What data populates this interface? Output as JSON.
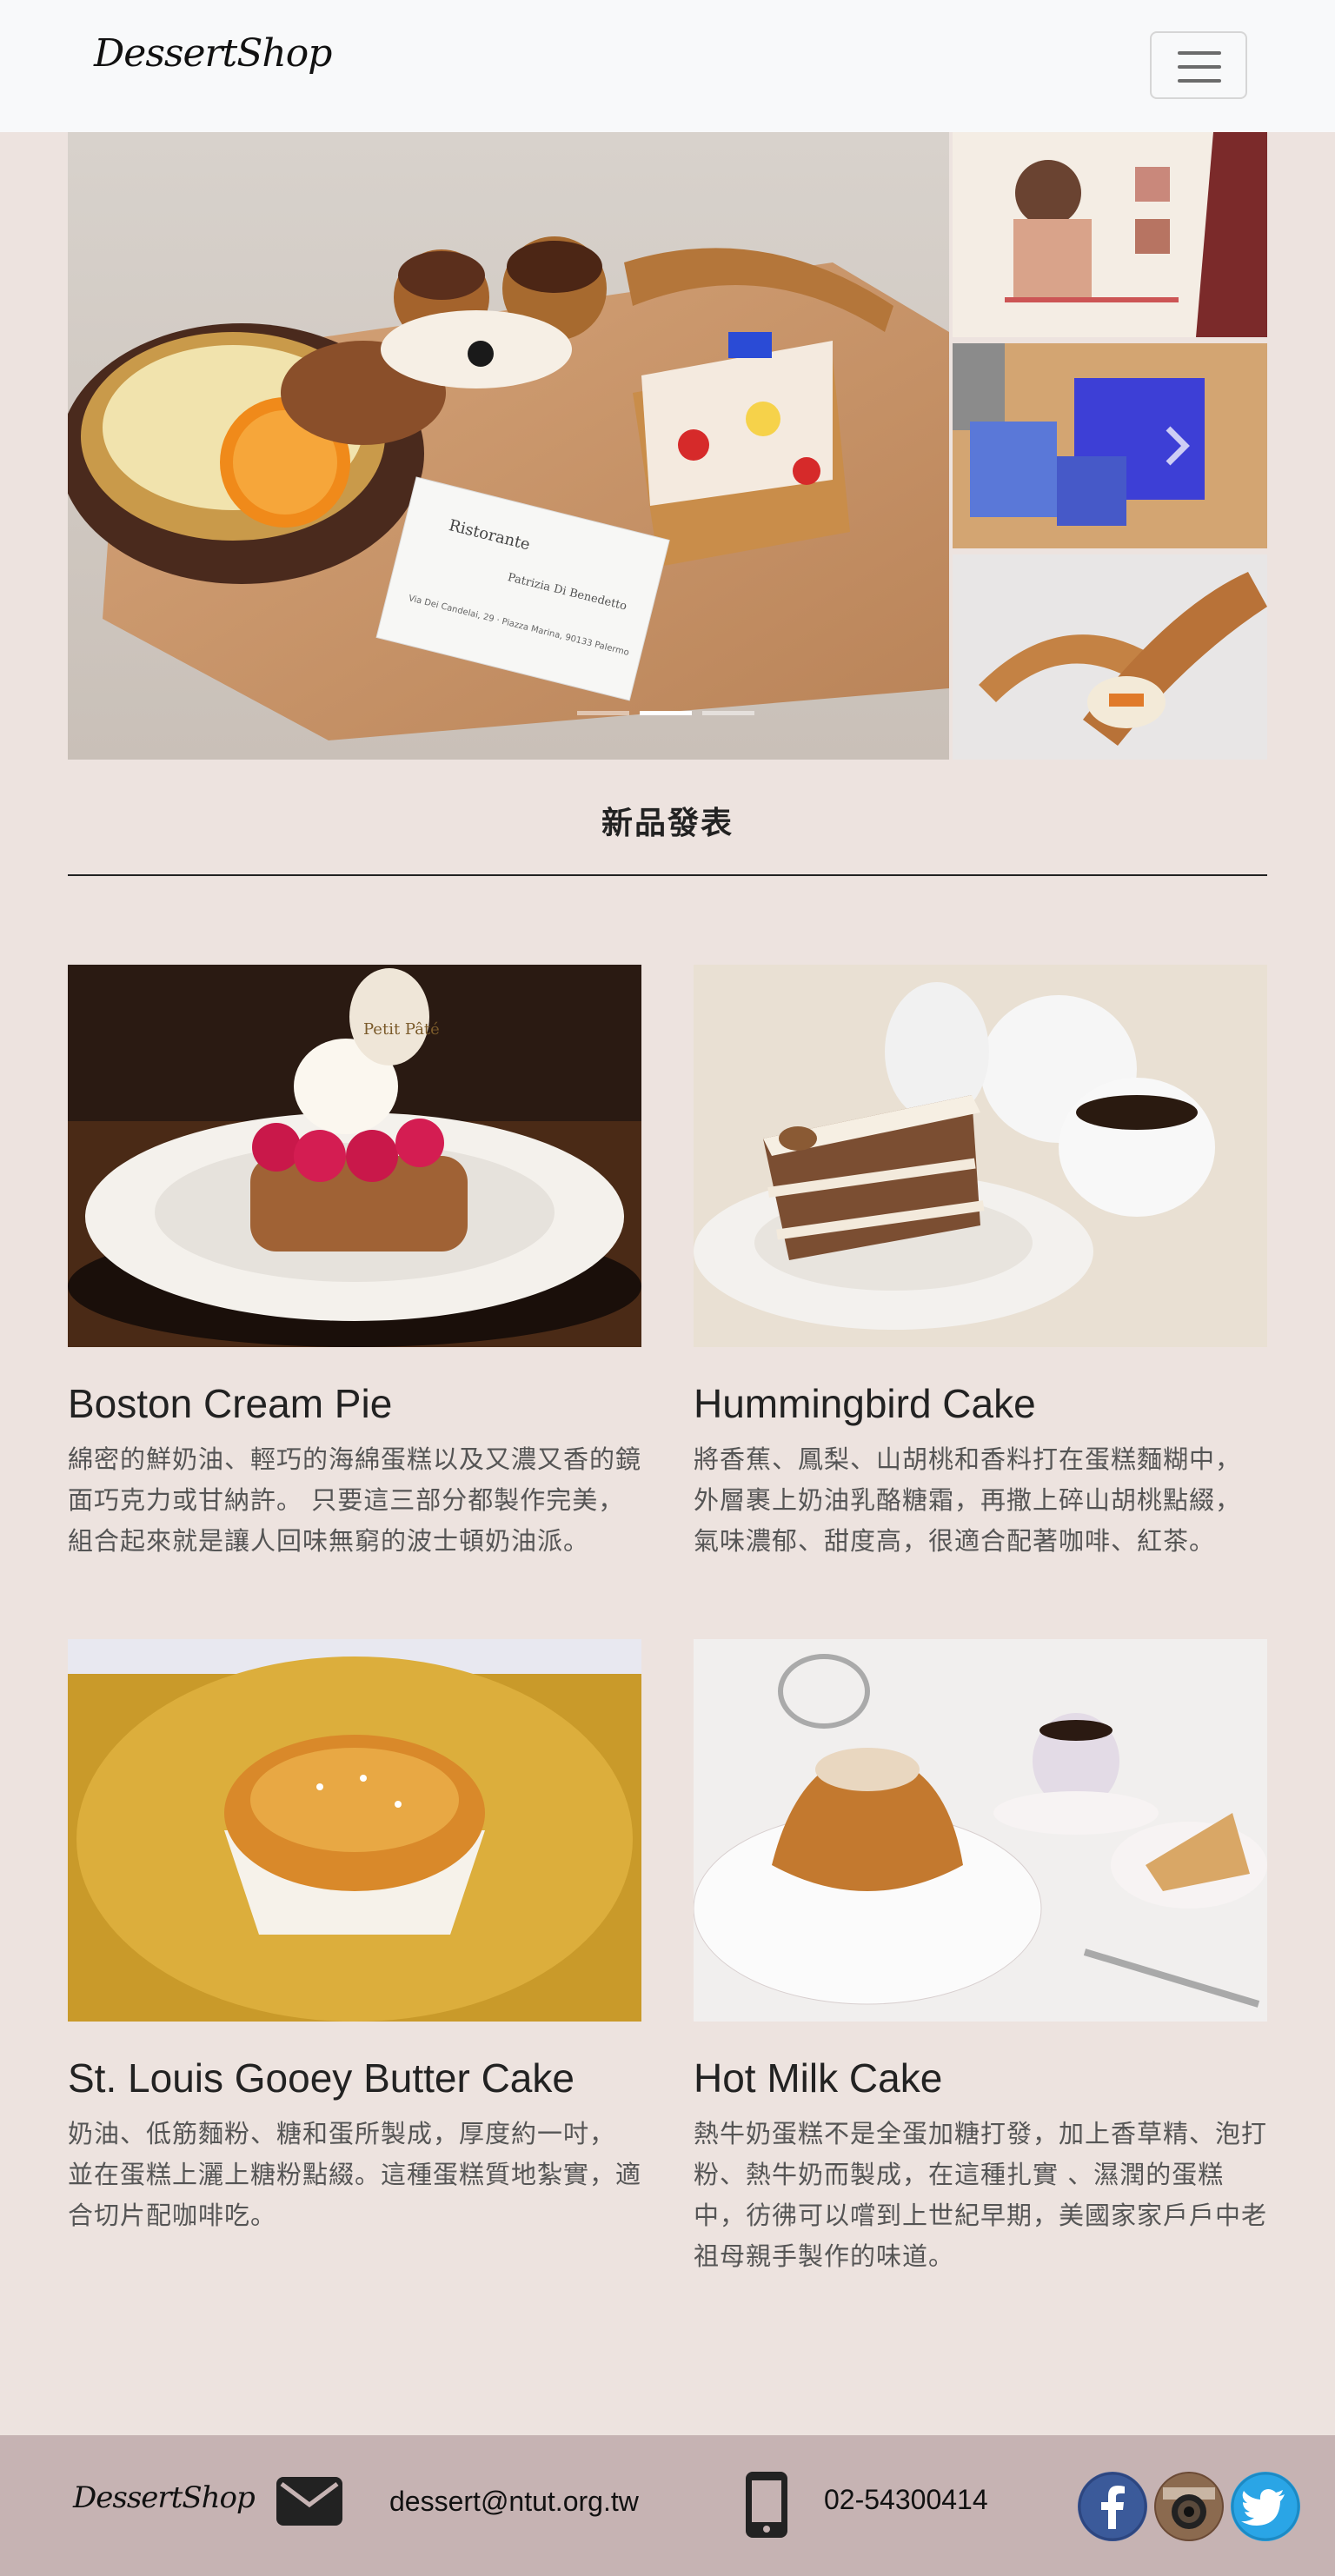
{
  "header": {
    "brand": "DessertShop",
    "menu_toggle_icon": "hamburger-icon"
  },
  "carousel": {
    "slide_count": 3,
    "active_index": 1,
    "next_icon": "chevron-right-icon",
    "main_card": {
      "business_name": "Ristorante",
      "person": "Patrizia Di Benedetto",
      "address": "Via Dei Candelai, 29 · Piazza Marina, 90133 Palermo"
    }
  },
  "section": {
    "title": "新品發表"
  },
  "products": [
    {
      "name": "Boston Cream Pie",
      "description": "綿密的鮮奶油、輕巧的海綿蛋糕以及又濃又香的鏡面巧克力或甘納許。 只要這三部分都製作完美，組合起來就是讓人回味無窮的波士頓奶油派。",
      "image_label": "Petit Pâté"
    },
    {
      "name": "Hummingbird Cake",
      "description": "將香蕉、鳳梨、山胡桃和香料打在蛋糕麵糊中， 外層裹上奶油乳酪糖霜，再撒上碎山胡桃點綴， 氣味濃郁、甜度高，很適合配著咖啡、紅茶。"
    },
    {
      "name": "St. Louis Gooey Butter Cake",
      "description": "奶油、低筋麵粉、糖和蛋所製成，厚度約一吋， 並在蛋糕上灑上糖粉點綴。這種蛋糕質地紮實，適合切片配咖啡吃。"
    },
    {
      "name": "Hot Milk Cake",
      "description": "熱牛奶蛋糕不是全蛋加糖打發，加上香草精、泡打粉、熱牛奶而製成，在這種扎實 、濕潤的蛋糕中，彷彿可以嚐到上世紀早期，美國家家戶戶中老祖母親手製作的味道。"
    }
  ],
  "footer": {
    "brand": "DessertShop",
    "email": "dessert@ntut.org.tw",
    "phone": "02-54300414",
    "icons": [
      "envelope-icon",
      "mobile-phone-icon",
      "facebook-icon",
      "instagram-icon",
      "twitter-icon"
    ]
  },
  "colors": {
    "page_bg": "#ede3df",
    "navbar_bg": "#f8f9fa",
    "footer_bg": "#c6b3b3",
    "facebook": "#3b5a9a",
    "twitter": "#2aa5e6"
  }
}
